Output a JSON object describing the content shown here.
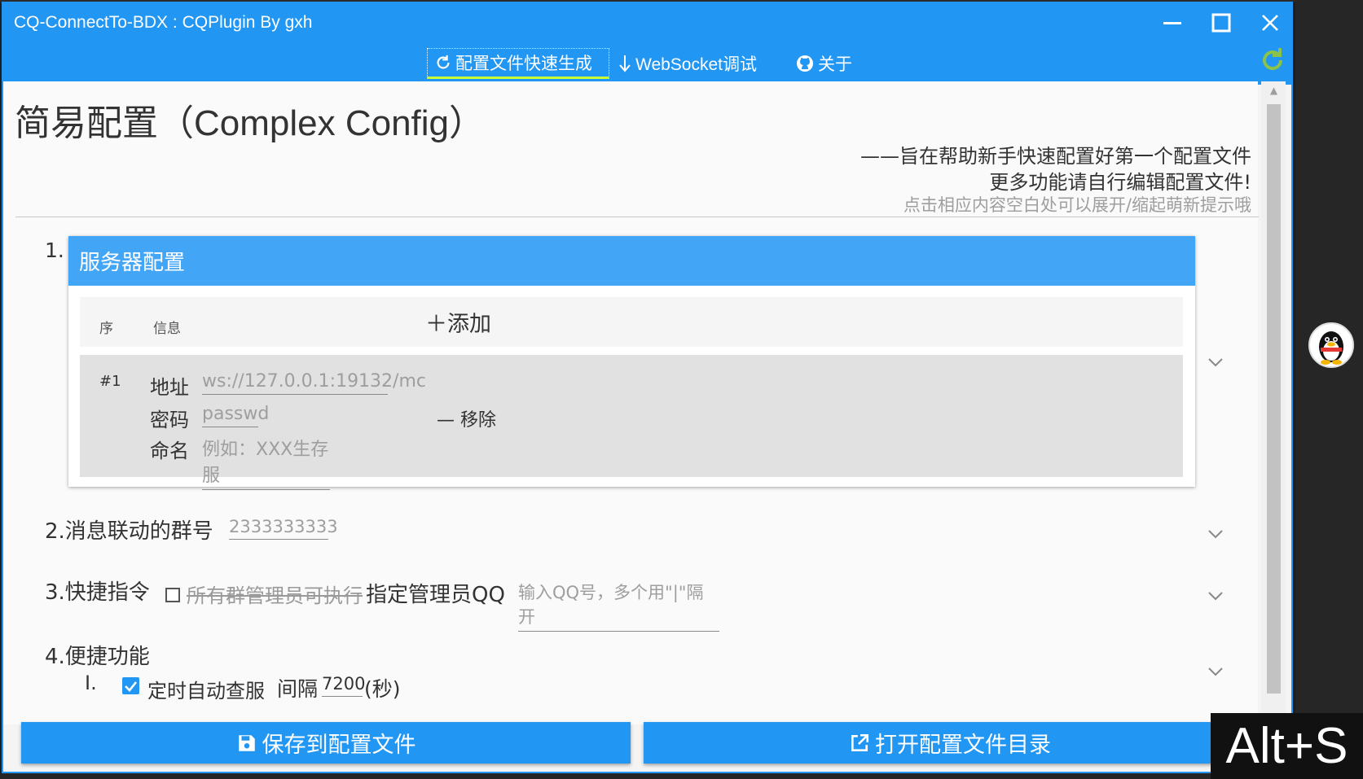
{
  "window": {
    "title": "CQ-ConnectTo-BDX : CQPlugin By gxh",
    "controls": {
      "minimize": "—",
      "maximize": "☐",
      "close": "✕"
    }
  },
  "tabs": [
    {
      "label": "配置文件快速生成",
      "icon": "refresh-icon",
      "active": true
    },
    {
      "label": "WebSocket调试",
      "icon": "download-arrow-icon",
      "active": false
    },
    {
      "label": "关于",
      "icon": "github-icon",
      "active": false
    }
  ],
  "header": {
    "title": "简易配置（Complex Config）",
    "subtitle_1": "——旨在帮助新手快速配置好第一个配置文件",
    "subtitle_2": "更多功能请自行编辑配置文件!",
    "hint": "点击相应内容空白处可以展开/缩起萌新提示哦"
  },
  "servers": {
    "index": "1.",
    "title": "服务器配置",
    "col_seq": "序",
    "col_info": "信息",
    "add_label": "添加",
    "rows": [
      {
        "idx": "#1",
        "address_label": "地址",
        "address_placeholder": "ws://127.0.0.1:19132/mc",
        "password_label": "密码",
        "password_placeholder": "passwd",
        "name_label": "命名",
        "name_placeholder": "例如：XXX生存服",
        "remove_label": "移除"
      }
    ]
  },
  "group": {
    "label": "2.消息联动的群号",
    "placeholder": "2333333333"
  },
  "commands": {
    "label": "3.快捷指令",
    "all_admins": "所有群管理员可执行",
    "specified": "指定管理员QQ",
    "placeholder": "输入QQ号，多个用\"|\"隔开",
    "all_admins_checked": false
  },
  "features": {
    "label": "4.便捷功能",
    "item_index": "Ⅰ.",
    "item_label": "定时自动查服",
    "interval_label": "间隔",
    "interval_value": "7200",
    "interval_unit": "(秒)",
    "item_checked": true
  },
  "footer": {
    "save_label": "保存到配置文件",
    "open_label": "打开配置文件目录"
  },
  "overlay": {
    "shortcut": "Alt+S"
  },
  "colors": {
    "accent": "#2196f3",
    "card_header": "#42a5f5",
    "active_tab_underline": "#c8ff32",
    "refresh_green": "#8bc34a"
  }
}
